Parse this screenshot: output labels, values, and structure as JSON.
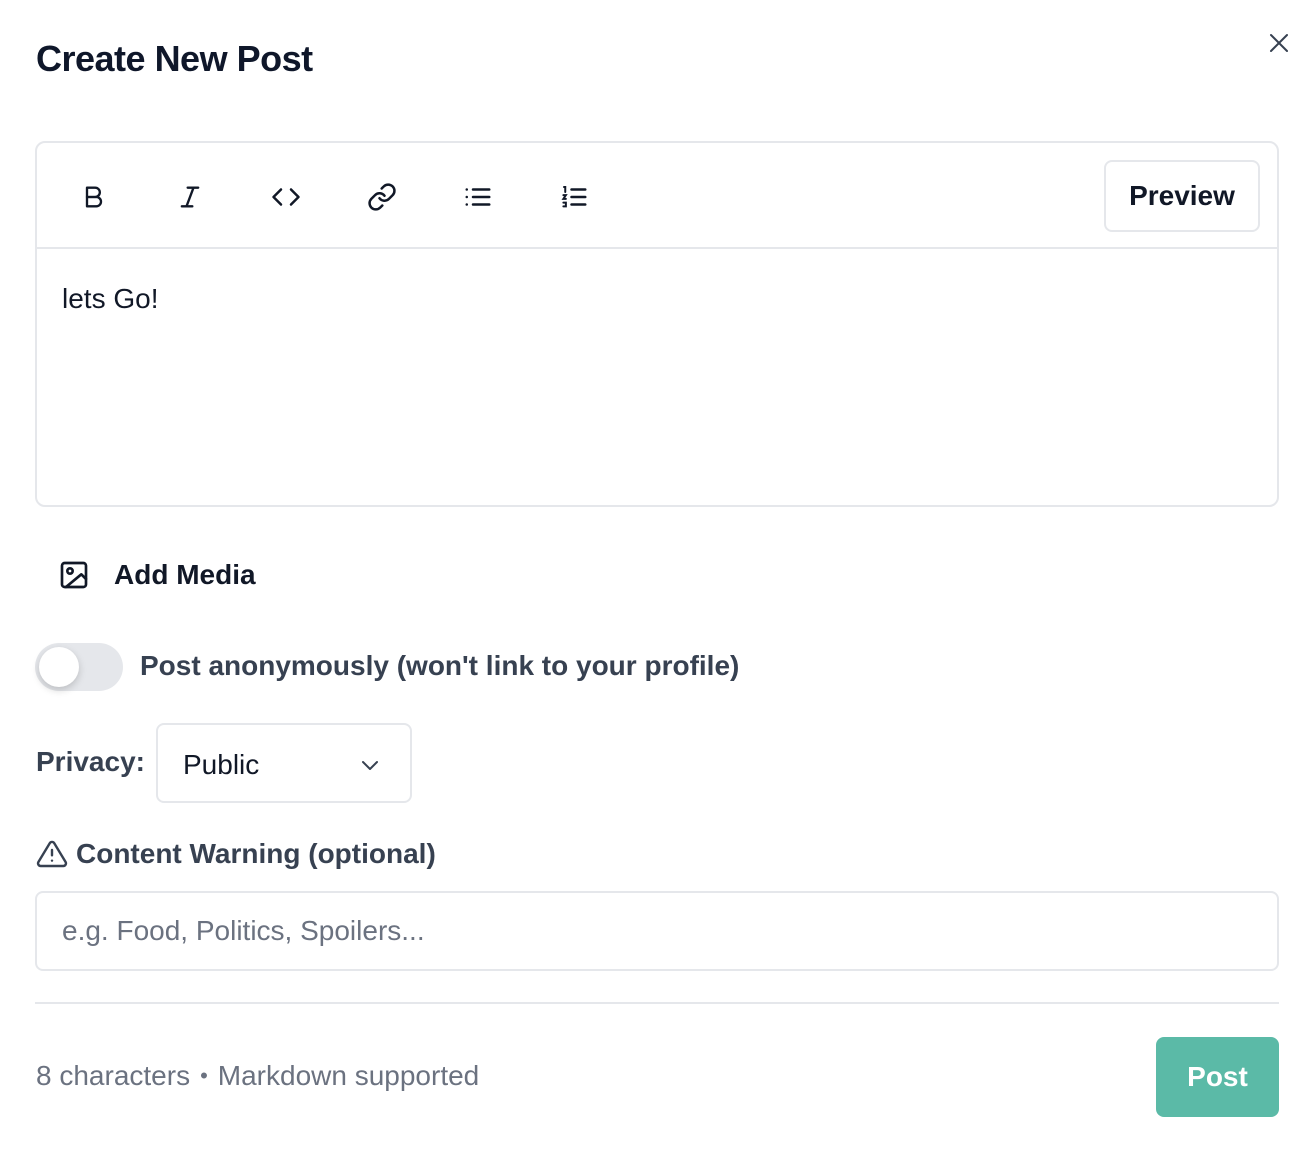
{
  "dialog": {
    "title": "Create New Post"
  },
  "toolbar": {
    "buttons": [
      {
        "name": "bold",
        "icon": "bold-icon"
      },
      {
        "name": "italic",
        "icon": "italic-icon"
      },
      {
        "name": "code",
        "icon": "code-icon"
      },
      {
        "name": "link",
        "icon": "link-icon"
      },
      {
        "name": "bulleted-list",
        "icon": "bulleted-list-icon"
      },
      {
        "name": "numbered-list",
        "icon": "numbered-list-icon"
      }
    ],
    "preview_label": "Preview"
  },
  "editor": {
    "content": "lets Go!"
  },
  "media": {
    "add_label": "Add Media",
    "icon": "image-icon"
  },
  "anonymous": {
    "label": "Post anonymously (won't link to your profile)",
    "enabled": false
  },
  "privacy": {
    "label": "Privacy:",
    "selected": "Public"
  },
  "content_warning": {
    "label": "Content Warning (optional)",
    "placeholder": "e.g. Food, Politics, Spoilers...",
    "value": ""
  },
  "footer": {
    "char_count": "8 characters",
    "separator": "•",
    "markdown_note": "Markdown supported",
    "post_label": "Post"
  },
  "colors": {
    "accent": "#5bbaa7",
    "border": "#e5e7eb",
    "muted_text": "#6b7280"
  }
}
